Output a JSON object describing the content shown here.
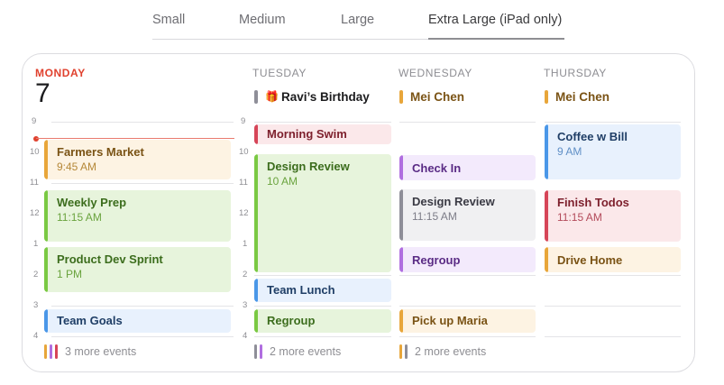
{
  "size_tabs": {
    "items": [
      "Small",
      "Medium",
      "Large",
      "Extra Large (iPad only)"
    ],
    "active": "Extra Large (iPad only)"
  },
  "colors": {
    "today_red": "#e0412e",
    "orange": "#e8a63a",
    "green": "#7ac943",
    "blue": "#4a97e8",
    "purple": "#b06ee0",
    "gray": "#8e8e98",
    "red": "#d64558"
  },
  "monday": {
    "name": "MONDAY",
    "date": "7",
    "hour_labels": [
      "9",
      "10",
      "11",
      "12",
      "1",
      "2",
      "3",
      "4"
    ],
    "events": [
      {
        "title": "Farmers Market",
        "time": "9:45 AM",
        "color": "orange"
      },
      {
        "title": "Weekly Prep",
        "time": "11:15 AM",
        "color": "green"
      },
      {
        "title": "Product Dev Sprint",
        "time": "1 PM",
        "color": "green"
      },
      {
        "title": "Team Goals",
        "time": "",
        "color": "blue"
      }
    ],
    "more_events": "3 more events"
  },
  "tuesday": {
    "name": "TUESDAY",
    "allday": "Ravi’s Birthday",
    "hour_labels": [
      "9",
      "10",
      "11",
      "12",
      "1",
      "2",
      "3",
      "4"
    ],
    "events": [
      {
        "title": "Morning Swim",
        "time": "",
        "color": "red"
      },
      {
        "title": "Design Review",
        "time": "10 AM",
        "color": "green"
      },
      {
        "title": "Team Lunch",
        "time": "",
        "color": "blue"
      },
      {
        "title": "Regroup",
        "time": "",
        "color": "green"
      }
    ],
    "more_events": "2 more events"
  },
  "wednesday": {
    "name": "WEDNESDAY",
    "allday": "Mei Chen",
    "events": [
      {
        "title": "Check In",
        "time": "",
        "color": "purple"
      },
      {
        "title": "Design Review",
        "time": "11:15 AM",
        "color": "gray"
      },
      {
        "title": "Regroup",
        "time": "",
        "color": "purple"
      },
      {
        "title": "Pick up Maria",
        "time": "",
        "color": "orange"
      }
    ],
    "more_events": "2 more events"
  },
  "thursday": {
    "name": "THURSDAY",
    "allday": "Mei Chen",
    "events": [
      {
        "title": "Coffee w Bill",
        "time": "9 AM",
        "color": "blue"
      },
      {
        "title": "Finish Todos",
        "time": "11:15 AM",
        "color": "red"
      },
      {
        "title": "Drive Home",
        "time": "",
        "color": "orange"
      }
    ]
  }
}
